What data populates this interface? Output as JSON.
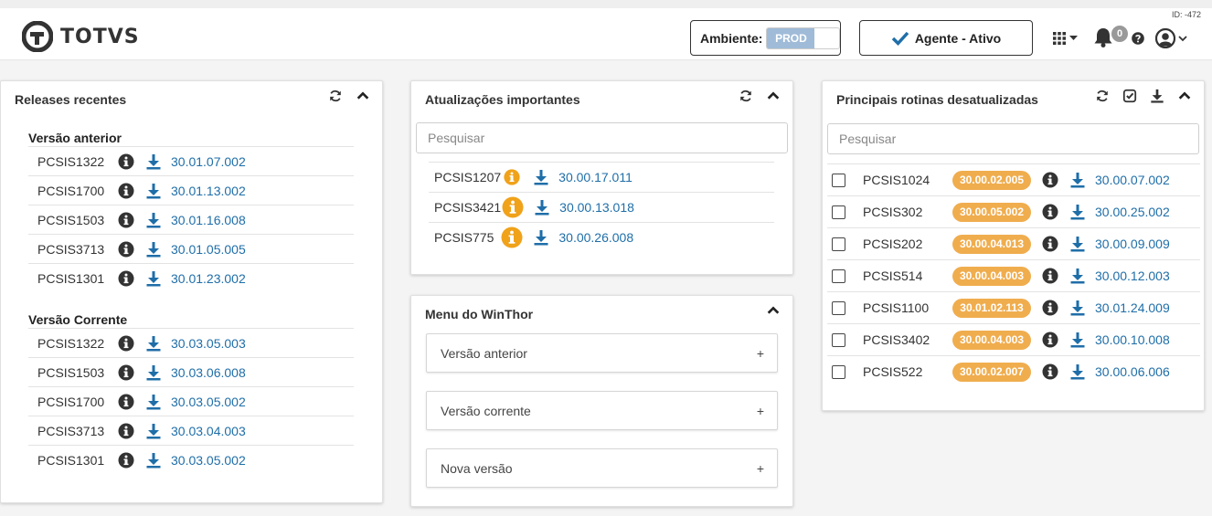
{
  "header": {
    "logo_text": "TOTVS",
    "id_label": "ID: -472",
    "ambiente_label": "Ambiente:",
    "ambiente_value": "PROD",
    "agente_label": "Agente - Ativo",
    "notifications_count": "0"
  },
  "releases": {
    "title": "Releases recentes",
    "anterior_title": "Versão anterior",
    "anterior": [
      {
        "name": "PCSIS1322",
        "version": "30.01.07.002"
      },
      {
        "name": "PCSIS1700",
        "version": "30.01.13.002"
      },
      {
        "name": "PCSIS1503",
        "version": "30.01.16.008"
      },
      {
        "name": "PCSIS3713",
        "version": "30.01.05.005"
      },
      {
        "name": "PCSIS1301",
        "version": "30.01.23.002"
      }
    ],
    "corrente_title": "Versão Corrente",
    "corrente": [
      {
        "name": "PCSIS1322",
        "version": "30.03.05.003"
      },
      {
        "name": "PCSIS1503",
        "version": "30.03.06.008"
      },
      {
        "name": "PCSIS1700",
        "version": "30.03.05.002"
      },
      {
        "name": "PCSIS3713",
        "version": "30.03.04.003"
      },
      {
        "name": "PCSIS1301",
        "version": "30.03.05.002"
      }
    ]
  },
  "atualizacoes": {
    "title": "Atualizações importantes",
    "search_placeholder": "Pesquisar",
    "items": [
      {
        "name": "PCSIS1207",
        "version": "30.00.17.011"
      },
      {
        "name": "PCSIS3421",
        "version": "30.00.13.018"
      },
      {
        "name": "PCSIS775",
        "version": "30.00.26.008"
      }
    ]
  },
  "menu": {
    "title": "Menu do WinThor",
    "items": [
      {
        "label": "Versão anterior",
        "toggle": "+"
      },
      {
        "label": "Versão corrente",
        "toggle": "+"
      },
      {
        "label": "Nova versão",
        "toggle": "+"
      }
    ]
  },
  "rotinas": {
    "title": "Principais rotinas desatualizadas",
    "search_placeholder": "Pesquisar",
    "items": [
      {
        "name": "PCSIS1024",
        "current": "30.00.02.005",
        "latest": "30.00.07.002"
      },
      {
        "name": "PCSIS302",
        "current": "30.00.05.002",
        "latest": "30.00.25.002"
      },
      {
        "name": "PCSIS202",
        "current": "30.00.04.013",
        "latest": "30.00.09.009"
      },
      {
        "name": "PCSIS514",
        "current": "30.00.04.003",
        "latest": "30.00.12.003"
      },
      {
        "name": "PCSIS1100",
        "current": "30.01.02.113",
        "latest": "30.01.24.009"
      },
      {
        "name": "PCSIS3402",
        "current": "30.00.04.003",
        "latest": "30.00.10.008"
      },
      {
        "name": "PCSIS522",
        "current": "30.00.02.007",
        "latest": "30.00.06.006"
      }
    ]
  },
  "colors": {
    "accent": "#1f6ea8",
    "badge_orange": "#f0ad4e",
    "prod_toggle": "#9fbbd8"
  },
  "icons": [
    "logo-icon",
    "check-icon",
    "apps-grid-icon",
    "bell-icon",
    "help-icon",
    "user-icon",
    "refresh-icon",
    "chevron-up-icon",
    "info-icon",
    "download-icon",
    "warning-info-icon",
    "check-square-icon"
  ]
}
